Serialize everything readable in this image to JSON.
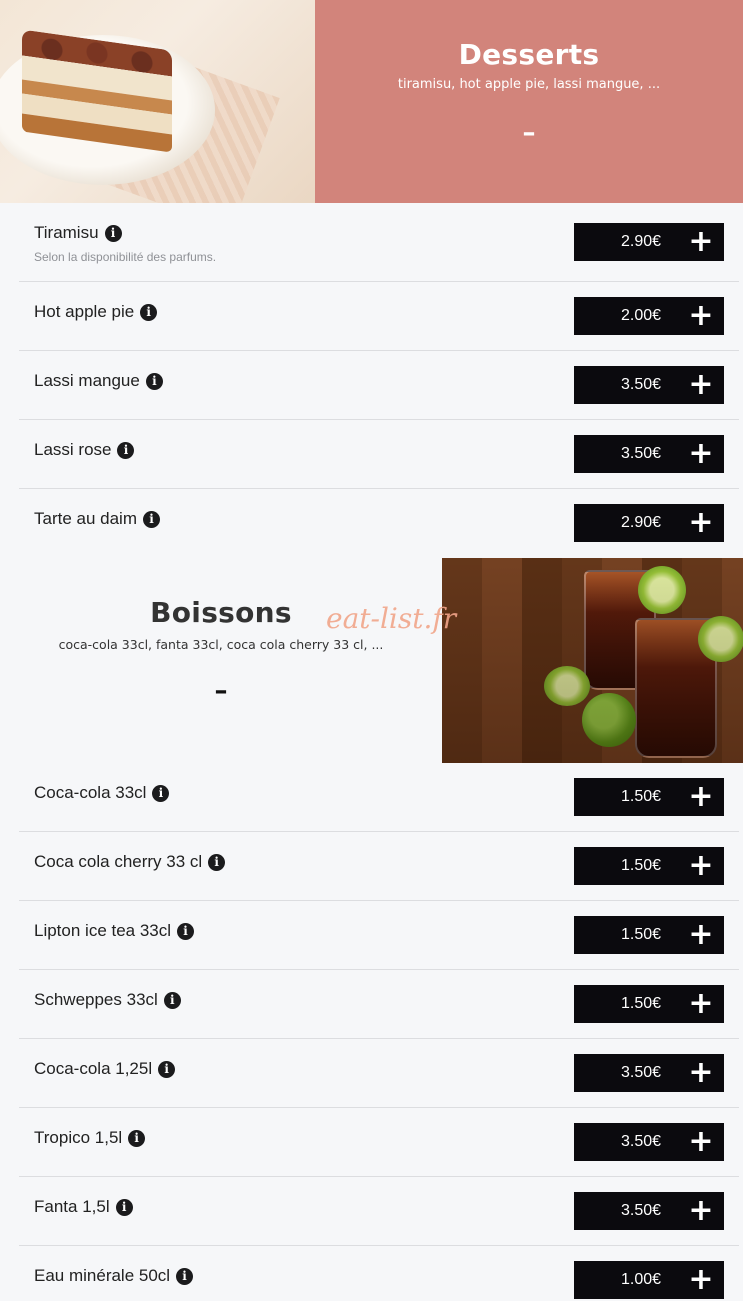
{
  "desserts": {
    "title": "Desserts",
    "subtitle": "tiramisu, hot apple pie, lassi mangue, ...",
    "collapse_symbol": "–",
    "image_icon": "tiramisu-image",
    "banner_color": "#d2847b",
    "items": [
      {
        "name": "Tiramisu",
        "description": "Selon la disponibilité des parfums.",
        "price": "2.90€"
      },
      {
        "name": "Hot apple pie",
        "description": "",
        "price": "2.00€"
      },
      {
        "name": "Lassi mangue",
        "description": "",
        "price": "3.50€"
      },
      {
        "name": "Lassi rose",
        "description": "",
        "price": "3.50€"
      },
      {
        "name": "Tarte au daim",
        "description": "",
        "price": "2.90€"
      }
    ]
  },
  "boissons": {
    "title": "Boissons",
    "subtitle": "coca-cola 33cl, fanta 33cl, coca cola cherry 33 cl, ...",
    "collapse_symbol": "–",
    "image_icon": "drinks-image",
    "items": [
      {
        "name": "Coca-cola 33cl",
        "price": "1.50€"
      },
      {
        "name": "Coca cola cherry 33 cl",
        "price": "1.50€"
      },
      {
        "name": "Lipton ice tea 33cl",
        "price": "1.50€"
      },
      {
        "name": "Schweppes 33cl",
        "price": "1.50€"
      },
      {
        "name": "Coca-cola 1,25l",
        "price": "3.50€"
      },
      {
        "name": "Tropico 1,5l",
        "price": "3.50€"
      },
      {
        "name": "Fanta 1,5l",
        "price": "3.50€"
      },
      {
        "name": "Eau minérale 50cl",
        "price": "1.00€"
      }
    ]
  },
  "watermark": "eat-list.fr",
  "info_symbol": "i",
  "add_symbol": "+",
  "colors": {
    "button_bg": "#0b0a0e",
    "page_bg": "#f6f7f9"
  }
}
